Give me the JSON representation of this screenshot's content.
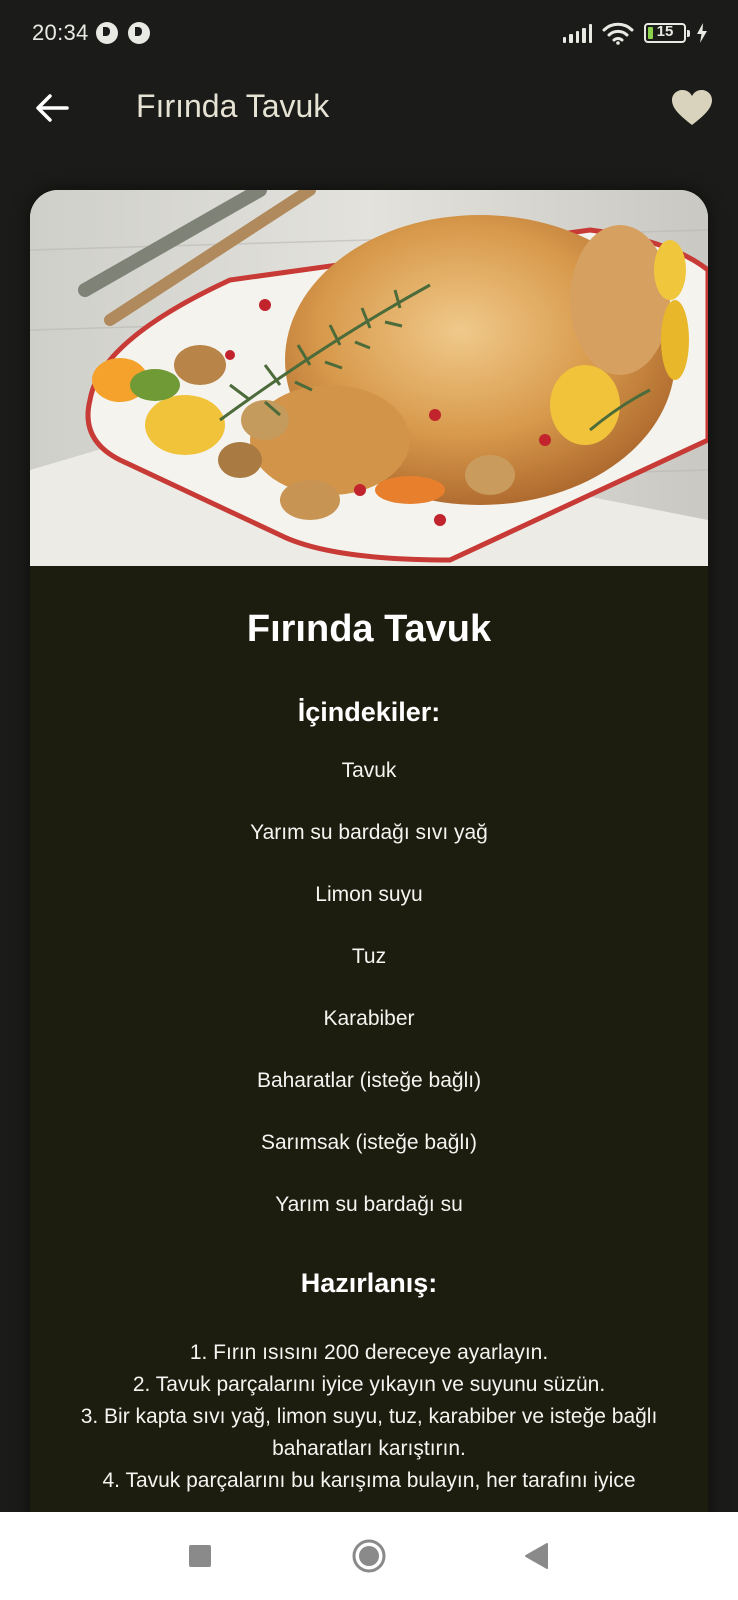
{
  "status_bar": {
    "time": "20:34",
    "battery_level": "15",
    "battery_percent": 15,
    "battery_color": "#8bd14b",
    "icons": [
      "app-notification-icon",
      "app-notification-icon",
      "signal-icon",
      "wifi-icon",
      "battery-icon",
      "charging-icon"
    ]
  },
  "app_bar": {
    "title": "Fırında Tavuk",
    "back_icon": "arrow-left-icon",
    "favorite_icon": "heart-icon",
    "favorite_color": "#d9d3bd"
  },
  "recipe": {
    "image_alt": "Roasted chicken with vegetables in a baking dish",
    "title": "Fırında Tavuk",
    "ingredients_heading": "İçindekiler:",
    "ingredients": [
      "Tavuk",
      "Yarım su bardağı sıvı yağ",
      "Limon suyu",
      "Tuz",
      "Karabiber",
      "Baharatlar (isteğe bağlı)",
      "Sarımsak (isteğe bağlı)",
      "Yarım su bardağı su"
    ],
    "preparation_heading": "Hazırlanış:",
    "steps": [
      "1. Fırın ısısını 200 dereceye ayarlayın.",
      "2. Tavuk parçalarını iyice yıkayın ve suyunu süzün.",
      "3. Bir kapta sıvı yağ, limon suyu, tuz, karabiber ve isteğe bağlı baharatları karıştırın.",
      "4. Tavuk parçalarını bu karışıma bulayın, her tarafını iyice"
    ]
  },
  "nav_bar": {
    "recents_icon": "square-recents-icon",
    "home_icon": "circle-home-icon",
    "back_icon": "triangle-back-icon"
  }
}
